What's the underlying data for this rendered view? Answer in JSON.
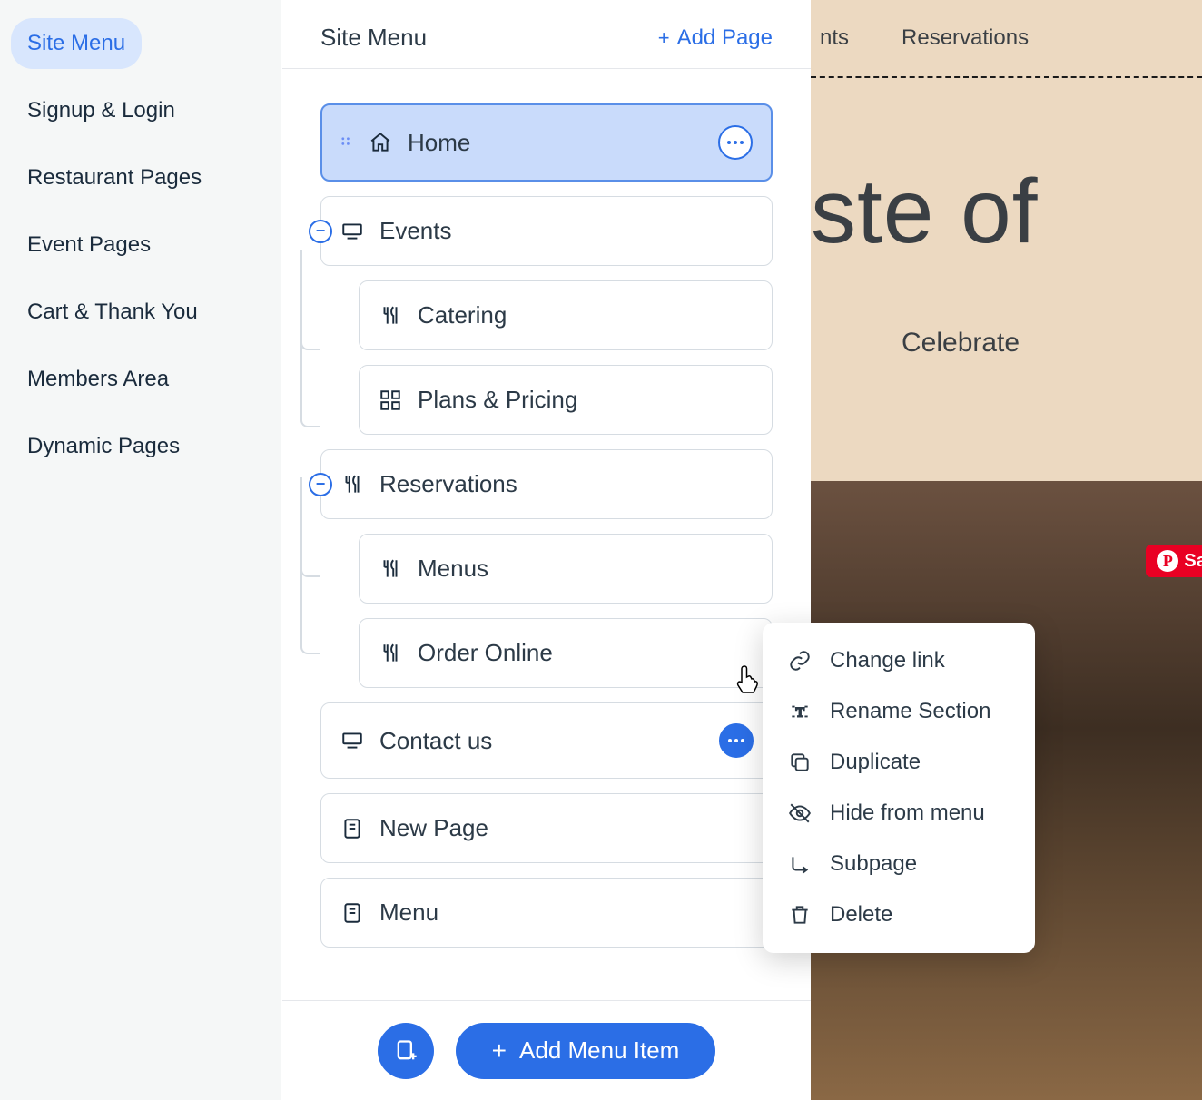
{
  "leftSidebar": {
    "items": [
      "Site Menu",
      "Signup & Login",
      "Restaurant Pages",
      "Event Pages",
      "Cart & Thank You",
      "Members Area",
      "Dynamic Pages"
    ]
  },
  "panel": {
    "title": "Site Menu",
    "addPage": "Add Page",
    "tree": {
      "home": "Home",
      "events": "Events",
      "catering": "Catering",
      "plans": "Plans & Pricing",
      "reservations": "Reservations",
      "menus": "Menus",
      "order": "Order Online",
      "contact": "Contact us",
      "newpage": "New Page",
      "menu": "Menu"
    },
    "footer": {
      "addMenuItem": "Add Menu Item"
    }
  },
  "contextMenu": {
    "changeLink": "Change link",
    "rename": "Rename Section",
    "duplicate": "Duplicate",
    "hide": "Hide from menu",
    "subpage": "Subpage",
    "delete": "Delete"
  },
  "preview": {
    "navEvents": "nts",
    "navReservations": "Reservations",
    "heroText": "ste of",
    "subText": "Celebrate",
    "saveLabel": "Sav"
  }
}
